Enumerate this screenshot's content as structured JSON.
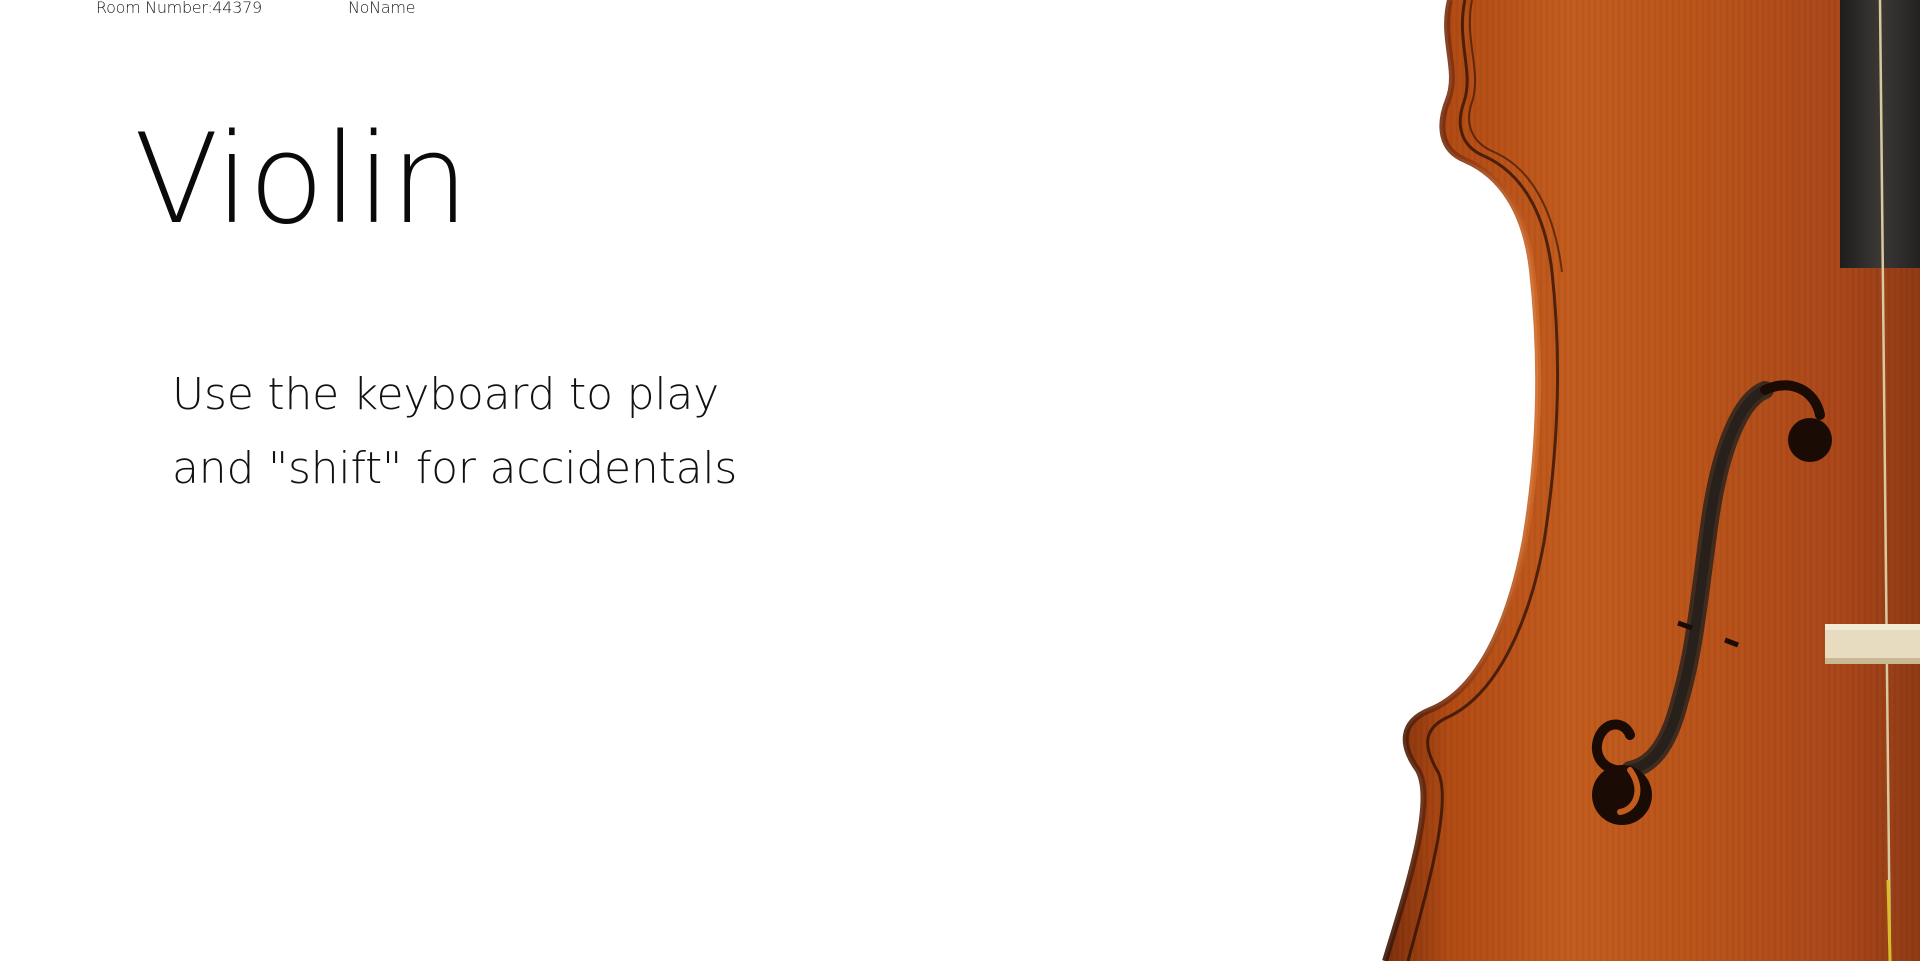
{
  "header": {
    "room_number": "Room Number:44379",
    "player_name": "NoName"
  },
  "main": {
    "title": "Violin",
    "instructions": [
      "Use the keyboard to play",
      "and \"shift\" for accidentals"
    ]
  },
  "image": {
    "icon": "violin-body-photo"
  },
  "colors": {
    "background": "#ffffff",
    "text": "#000000",
    "wood": "#b8531a",
    "wood_dark": "#6e2a0a",
    "fingerboard": "#2f2c2b",
    "bridge": "#e8dcc0"
  }
}
